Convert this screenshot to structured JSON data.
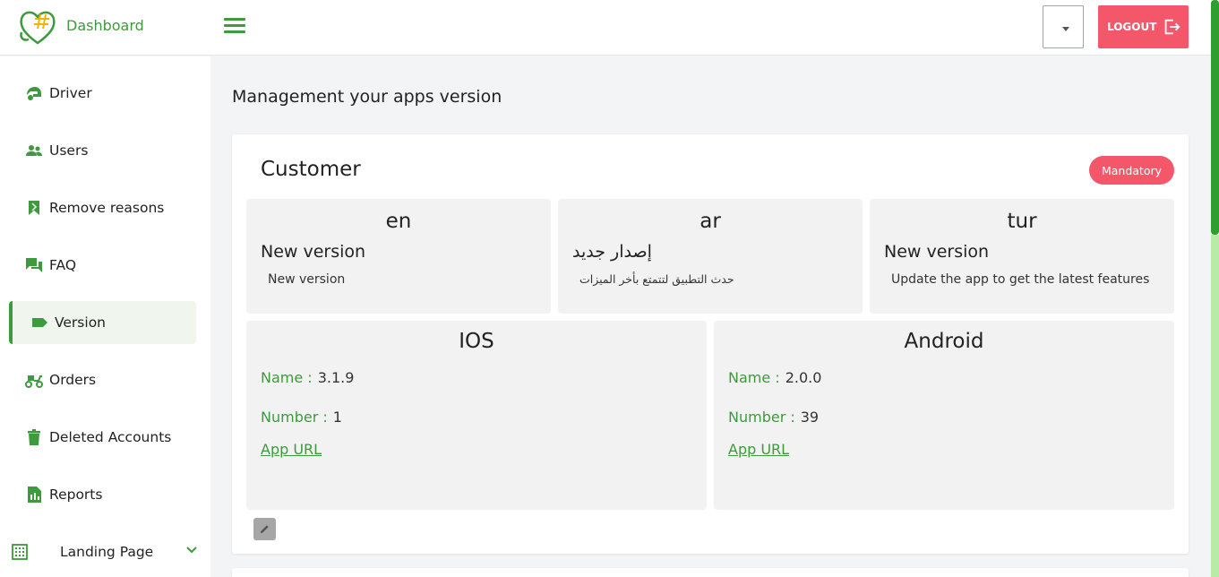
{
  "header": {
    "brand": "Dashboard",
    "logout_label": "LOGOUT"
  },
  "sidebar": {
    "items": [
      {
        "label": "Driver",
        "icon": "driver-icon"
      },
      {
        "label": "Users",
        "icon": "users-icon"
      },
      {
        "label": "Remove reasons",
        "icon": "bookmark-icon"
      },
      {
        "label": "FAQ",
        "icon": "chat-icon"
      },
      {
        "label": "Version",
        "icon": "tag-icon",
        "active": true
      },
      {
        "label": "Orders",
        "icon": "scooter-icon"
      },
      {
        "label": "Deleted Accounts",
        "icon": "trash-icon"
      },
      {
        "label": "Reports",
        "icon": "report-icon"
      },
      {
        "label": "Landing Page",
        "icon": "grid-icon"
      }
    ]
  },
  "main": {
    "page_title": "Management your apps version",
    "card": {
      "title": "Customer",
      "badge": "Mandatory",
      "languages": [
        {
          "code": "en",
          "title": "New version",
          "description": "New version"
        },
        {
          "code": "ar",
          "title": "إصدار جديد",
          "description": "حدث التطبيق لتتمتع بأخر الميزات"
        },
        {
          "code": "tur",
          "title": "New version",
          "description": "Update the app to get the latest features"
        }
      ],
      "platforms": [
        {
          "name": "IOS",
          "name_label": "Name :",
          "name_value": "3.1.9",
          "number_label": "Number :",
          "number_value": "1",
          "url_label": "App URL"
        },
        {
          "name": "Android",
          "name_label": "Name :",
          "name_value": "2.0.0",
          "number_label": "Number :",
          "number_value": "39",
          "url_label": "App URL"
        }
      ]
    }
  },
  "colors": {
    "accent": "#3d9a3d",
    "danger": "#f4566a",
    "panel": "#f2f2f2"
  }
}
